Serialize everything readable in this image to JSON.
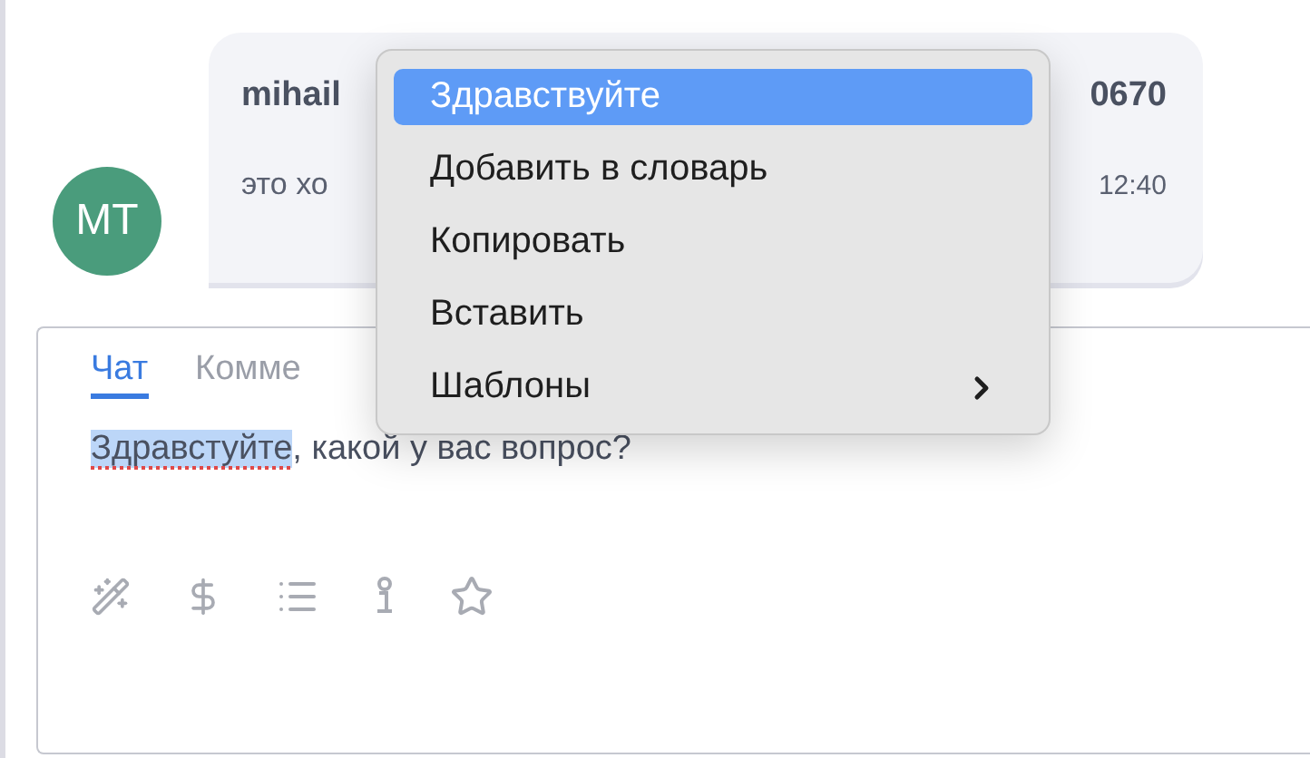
{
  "message": {
    "avatar": "MT",
    "sender": "mihail",
    "sender_tail": "0670",
    "text": "это хо",
    "time": "12:40"
  },
  "composer": {
    "tabs": [
      {
        "label": "Чат",
        "selected": true
      },
      {
        "label": "Комме",
        "selected": false
      }
    ],
    "selected_text": "Здравстуйте",
    "misspelled": true,
    "rest_text": ", какой у вас вопрос?"
  },
  "context_menu": [
    {
      "label": "Здравствуйте",
      "selected": true,
      "has_submenu": false
    },
    {
      "label": "Добавить в словарь",
      "selected": false,
      "has_submenu": false
    },
    {
      "label": "Копировать",
      "selected": false,
      "has_submenu": false
    },
    {
      "label": "Вставить",
      "selected": false,
      "has_submenu": false
    },
    {
      "label": "Шаблоны",
      "selected": false,
      "has_submenu": true
    }
  ]
}
